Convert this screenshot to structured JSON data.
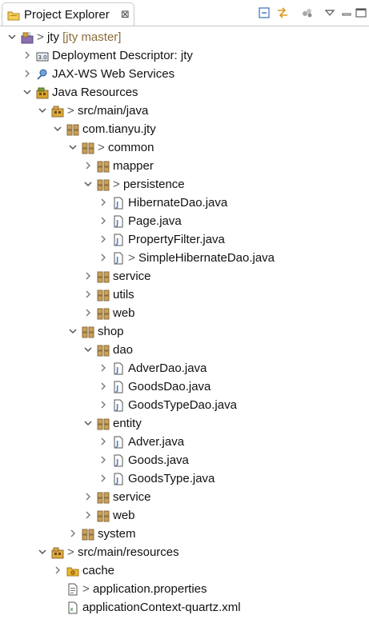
{
  "view": {
    "title": "Project Explorer",
    "close_glyph": "⊠",
    "toolbar": [
      {
        "name": "collapse-all-icon"
      },
      {
        "name": "link-with-editor-icon"
      },
      {
        "name": "focus-on-active-task-icon"
      },
      {
        "name": "view-menu-icon"
      },
      {
        "name": "minimize-icon"
      },
      {
        "name": "maximize-icon"
      }
    ]
  },
  "colors": {
    "package": "#8a6d3b",
    "java_file": "#ffffff",
    "folder": "#e8b832",
    "library": "#8c6fb0"
  },
  "tree": [
    {
      "depth": 0,
      "twisty": "expanded",
      "icon": "project",
      "dec": "> ",
      "label": "jty",
      "extra": "[jty master]"
    },
    {
      "depth": 1,
      "twisty": "collapsed",
      "icon": "deployment",
      "dec": "",
      "label": "Deployment Descriptor: jty"
    },
    {
      "depth": 1,
      "twisty": "collapsed",
      "icon": "webservices",
      "dec": "",
      "label": "JAX-WS Web Services"
    },
    {
      "depth": 1,
      "twisty": "expanded",
      "icon": "java-resources",
      "dec": "",
      "label": "Java Resources"
    },
    {
      "depth": 2,
      "twisty": "expanded",
      "icon": "source-folder",
      "dec": "> ",
      "label": "src/main/java"
    },
    {
      "depth": 3,
      "twisty": "expanded",
      "icon": "package",
      "dec": "",
      "label": "com.tianyu.jty"
    },
    {
      "depth": 4,
      "twisty": "expanded",
      "icon": "package",
      "dec": "> ",
      "label": "common"
    },
    {
      "depth": 5,
      "twisty": "collapsed",
      "icon": "package",
      "dec": "",
      "label": "mapper"
    },
    {
      "depth": 5,
      "twisty": "expanded",
      "icon": "package",
      "dec": "> ",
      "label": "persistence"
    },
    {
      "depth": 6,
      "twisty": "collapsed",
      "icon": "java-file",
      "dec": "",
      "label": "HibernateDao.java"
    },
    {
      "depth": 6,
      "twisty": "collapsed",
      "icon": "java-file",
      "dec": "",
      "label": "Page.java"
    },
    {
      "depth": 6,
      "twisty": "collapsed",
      "icon": "java-file",
      "dec": "",
      "label": "PropertyFilter.java"
    },
    {
      "depth": 6,
      "twisty": "collapsed",
      "icon": "java-file",
      "dec": "> ",
      "label": "SimpleHibernateDao.java"
    },
    {
      "depth": 5,
      "twisty": "collapsed",
      "icon": "package",
      "dec": "",
      "label": "service"
    },
    {
      "depth": 5,
      "twisty": "collapsed",
      "icon": "package",
      "dec": "",
      "label": "utils"
    },
    {
      "depth": 5,
      "twisty": "collapsed",
      "icon": "package",
      "dec": "",
      "label": "web"
    },
    {
      "depth": 4,
      "twisty": "expanded",
      "icon": "package",
      "dec": "",
      "label": "shop"
    },
    {
      "depth": 5,
      "twisty": "expanded",
      "icon": "package",
      "dec": "",
      "label": "dao"
    },
    {
      "depth": 6,
      "twisty": "collapsed",
      "icon": "java-file",
      "dec": "",
      "label": "AdverDao.java"
    },
    {
      "depth": 6,
      "twisty": "collapsed",
      "icon": "java-file",
      "dec": "",
      "label": "GoodsDao.java"
    },
    {
      "depth": 6,
      "twisty": "collapsed",
      "icon": "java-file",
      "dec": "",
      "label": "GoodsTypeDao.java"
    },
    {
      "depth": 5,
      "twisty": "expanded",
      "icon": "package",
      "dec": "",
      "label": "entity"
    },
    {
      "depth": 6,
      "twisty": "collapsed",
      "icon": "java-file",
      "dec": "",
      "label": "Adver.java"
    },
    {
      "depth": 6,
      "twisty": "collapsed",
      "icon": "java-file",
      "dec": "",
      "label": "Goods.java"
    },
    {
      "depth": 6,
      "twisty": "collapsed",
      "icon": "java-file",
      "dec": "",
      "label": "GoodsType.java"
    },
    {
      "depth": 5,
      "twisty": "collapsed",
      "icon": "package",
      "dec": "",
      "label": "service"
    },
    {
      "depth": 5,
      "twisty": "collapsed",
      "icon": "package",
      "dec": "",
      "label": "web"
    },
    {
      "depth": 4,
      "twisty": "collapsed",
      "icon": "package",
      "dec": "",
      "label": "system"
    },
    {
      "depth": 2,
      "twisty": "expanded",
      "icon": "source-folder",
      "dec": "> ",
      "label": "src/main/resources"
    },
    {
      "depth": 3,
      "twisty": "collapsed",
      "icon": "folder",
      "dec": "",
      "label": "cache"
    },
    {
      "depth": 3,
      "twisty": "none",
      "icon": "properties-file",
      "dec": "> ",
      "label": "application.properties"
    },
    {
      "depth": 3,
      "twisty": "none",
      "icon": "xml-file",
      "dec": "",
      "label": "applicationContext-quartz.xml"
    }
  ]
}
